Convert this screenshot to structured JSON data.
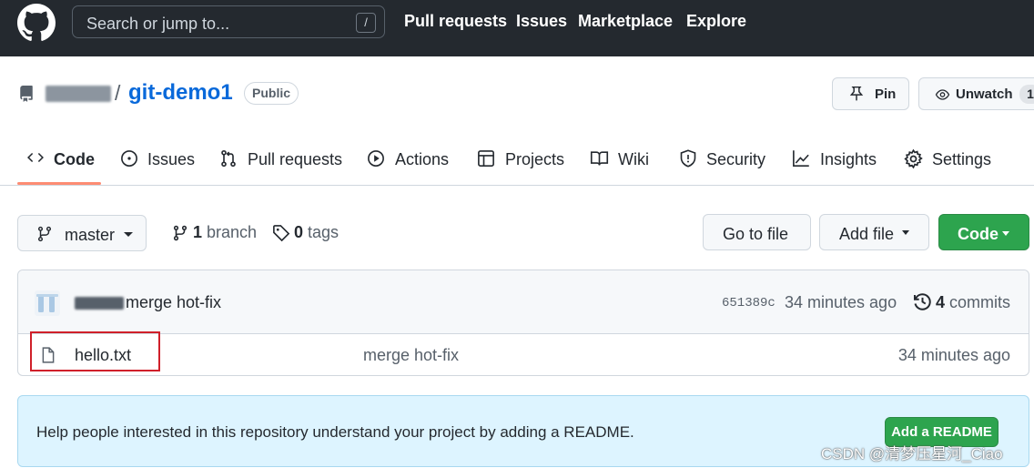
{
  "header": {
    "search_placeholder": "Search or jump to...",
    "search_shortcut": "/",
    "nav": [
      "Pull requests",
      "Issues",
      "Marketplace",
      "Explore"
    ]
  },
  "repo": {
    "separator": "/",
    "name": "git-demo1",
    "visibility": "Public",
    "pin_label": "Pin",
    "watch_label": "Unwatch",
    "watch_count": "1"
  },
  "tabs": [
    {
      "label": "Code",
      "icon": "code-icon"
    },
    {
      "label": "Issues",
      "icon": "issue-icon"
    },
    {
      "label": "Pull requests",
      "icon": "pull-request-icon"
    },
    {
      "label": "Actions",
      "icon": "play-icon"
    },
    {
      "label": "Projects",
      "icon": "table-icon"
    },
    {
      "label": "Wiki",
      "icon": "book-icon"
    },
    {
      "label": "Security",
      "icon": "shield-icon"
    },
    {
      "label": "Insights",
      "icon": "graph-icon"
    },
    {
      "label": "Settings",
      "icon": "gear-icon"
    }
  ],
  "branch_bar": {
    "branch": "master",
    "branch_count": "1",
    "branch_label": "branch",
    "tag_count": "0",
    "tag_label": "tags",
    "go_to_file": "Go to file",
    "add_file": "Add file",
    "code": "Code"
  },
  "latest_commit": {
    "message": "merge hot-fix",
    "sha": "651389c",
    "time": "34 minutes ago",
    "commit_count": "4",
    "commit_label": "commits"
  },
  "files": [
    {
      "name": "hello.txt",
      "commit": "merge hot-fix",
      "time": "34 minutes ago"
    }
  ],
  "readme_prompt": {
    "text": "Help people interested in this repository understand your project by adding a README.",
    "button": "Add a README"
  },
  "watermark": "CSDN @清梦压星河_Ciao",
  "colors": {
    "header_bg": "#24292f",
    "link": "#0969da",
    "green": "#2da44e",
    "tab_underline": "#fd8c73",
    "highlight": "#d0202a"
  }
}
